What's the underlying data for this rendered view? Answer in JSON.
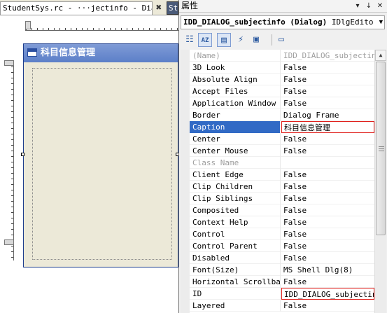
{
  "editor": {
    "tab_active": "StudentSys.rc - ···jectinfo - Dialog*",
    "tab_close_glyph": "✖",
    "tab_second": "St",
    "dialog": {
      "caption": "科目信息管理",
      "icon": "dialog-window-icon"
    }
  },
  "properties": {
    "title": "属性",
    "title_buttons": {
      "pin": "▾",
      "autohide": "↓",
      "close": "✕"
    },
    "object_selector": {
      "name": "IDD_DIALOG_subjectinfo (Dialog)",
      "type": " IDlgEdito",
      "arrow": "▼"
    },
    "toolbar": [
      {
        "name": "categorized-icon",
        "glyph": "☷",
        "active": false
      },
      {
        "name": "alphabetical-icon",
        "glyph": "AZ",
        "active": true
      },
      {
        "name": "properties-icon",
        "glyph": "▤",
        "active": true
      },
      {
        "name": "events-icon",
        "glyph": "⚡",
        "active": false
      },
      {
        "name": "messages-icon",
        "glyph": "▣",
        "active": false
      },
      {
        "name": "property-pages-icon",
        "glyph": "▭",
        "active": false
      }
    ],
    "rows": [
      {
        "name": "(Name)",
        "value": "IDD_DIALOG_subjectinfo",
        "disabled": true
      },
      {
        "name": "3D Look",
        "value": "False"
      },
      {
        "name": "Absolute Align",
        "value": "False"
      },
      {
        "name": "Accept Files",
        "value": "False"
      },
      {
        "name": "Application Window",
        "value": "False"
      },
      {
        "name": "Border",
        "value": "Dialog Frame"
      },
      {
        "name": "Caption",
        "value": "科目信息管理",
        "selected": true,
        "boxed": true
      },
      {
        "name": "Center",
        "value": "False"
      },
      {
        "name": "Center Mouse",
        "value": "False"
      },
      {
        "name": "Class Name",
        "value": "",
        "disabled": true
      },
      {
        "name": "Client Edge",
        "value": "False"
      },
      {
        "name": "Clip Children",
        "value": "False"
      },
      {
        "name": "Clip Siblings",
        "value": "False"
      },
      {
        "name": "Composited",
        "value": "False"
      },
      {
        "name": "Context Help",
        "value": "False"
      },
      {
        "name": "Control",
        "value": "False"
      },
      {
        "name": "Control Parent",
        "value": "False"
      },
      {
        "name": "Disabled",
        "value": "False"
      },
      {
        "name": "Font(Size)",
        "value": "MS Shell Dlg(8)"
      },
      {
        "name": "Horizontal Scrollbar",
        "value": "False"
      },
      {
        "name": "ID",
        "value": "IDD_DIALOG_subjectinfo",
        "boxed": true
      },
      {
        "name": "Layered",
        "value": "False"
      }
    ],
    "scroll_up_glyph": "▲"
  },
  "colors": {
    "selection": "#316ac5",
    "highlight_box": "#e0201c",
    "dialog_title": "#5c7fc8"
  }
}
